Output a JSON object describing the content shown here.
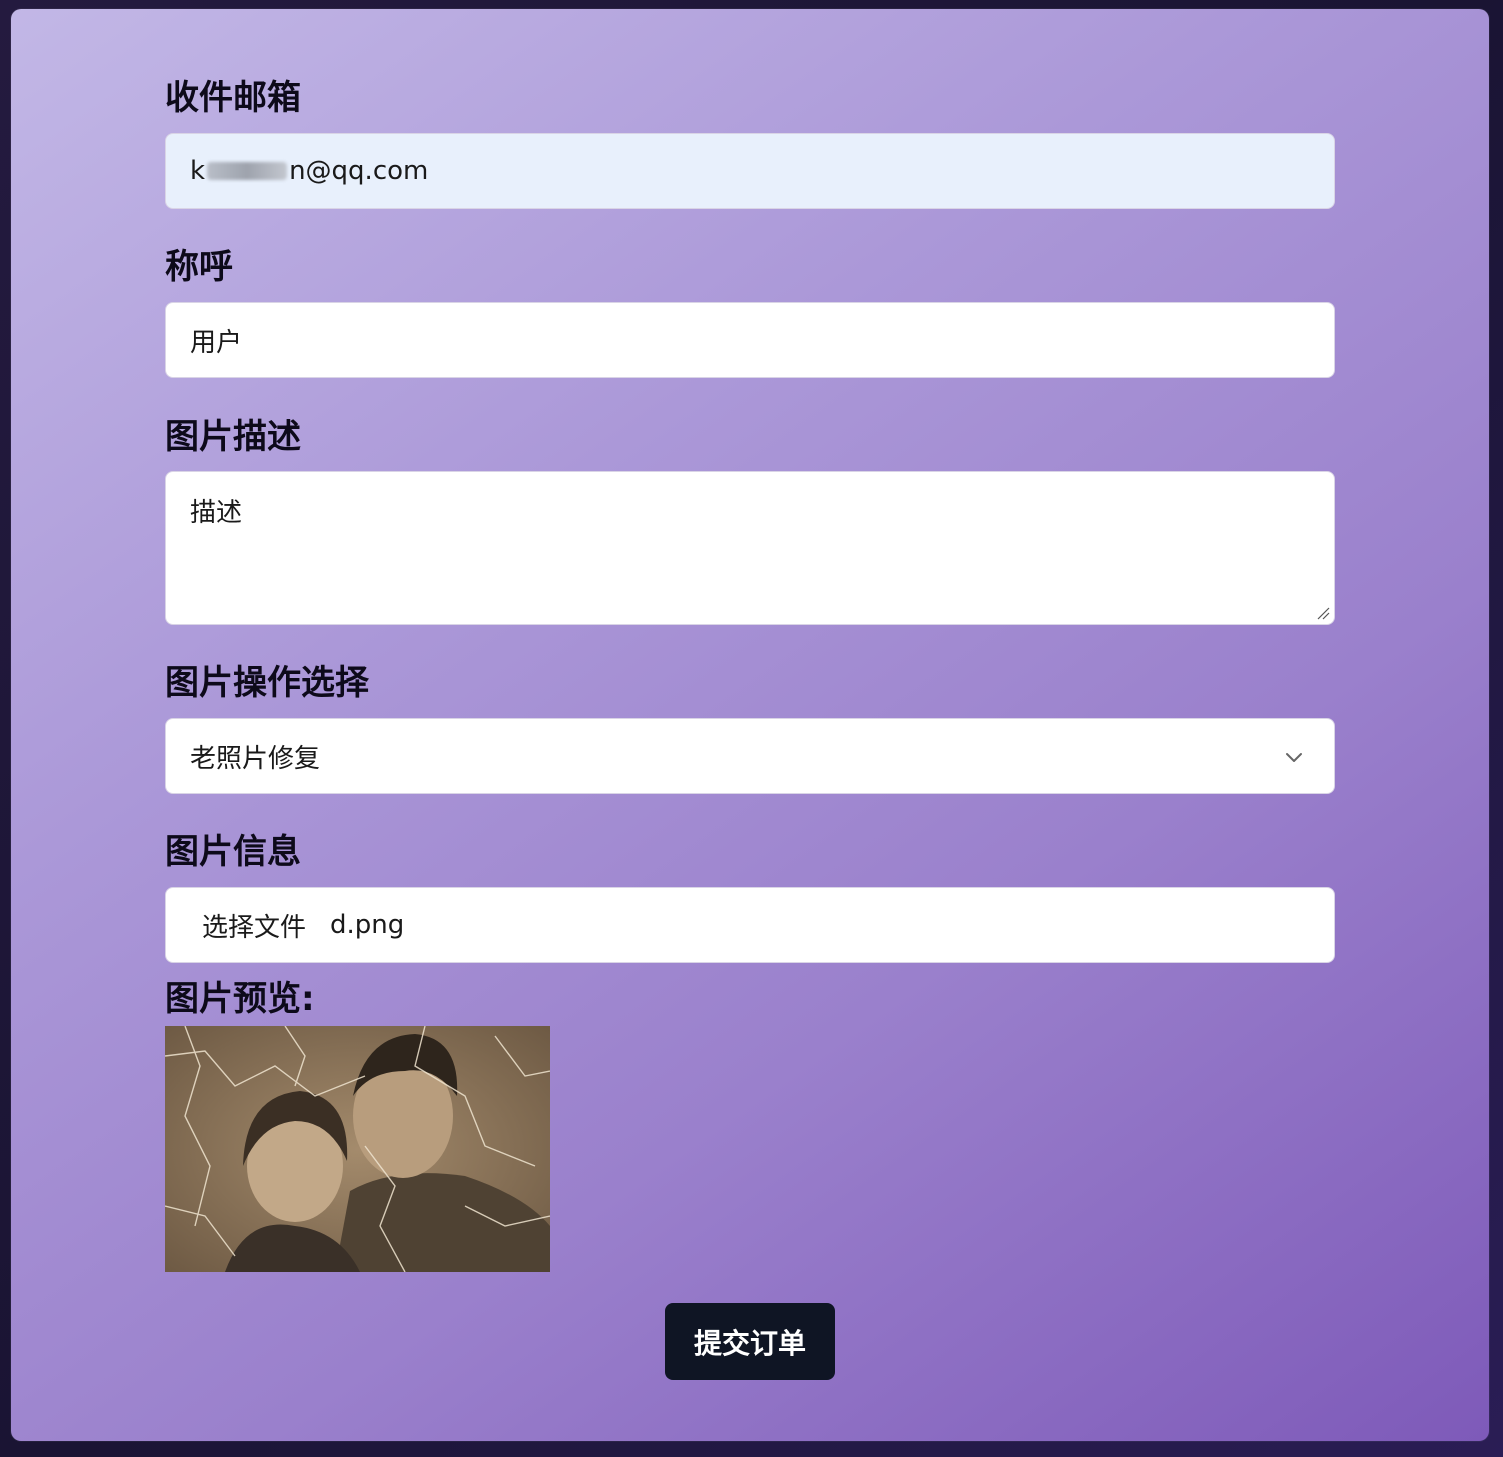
{
  "form": {
    "email_label": "收件邮箱",
    "email_prefix": "k",
    "email_suffix": "n@qq.com",
    "name_label": "称呼",
    "name_value": "用户",
    "desc_label": "图片描述",
    "desc_value": "描述",
    "op_label": "图片操作选择",
    "op_selected": "老照片修复",
    "file_label": "图片信息",
    "file_button": "选择文件",
    "file_name": "d.png",
    "preview_label": "图片预览:",
    "submit_label": "提交订单"
  },
  "icons": {
    "dropdown": "chevron-down-icon",
    "resize": "resize-grip-icon"
  },
  "colors": {
    "panel_gradient_start": "#c2b7e6",
    "panel_gradient_end": "#7e5ab9",
    "email_field_bg": "#e8f0fc",
    "submit_bg": "#0f1524"
  }
}
